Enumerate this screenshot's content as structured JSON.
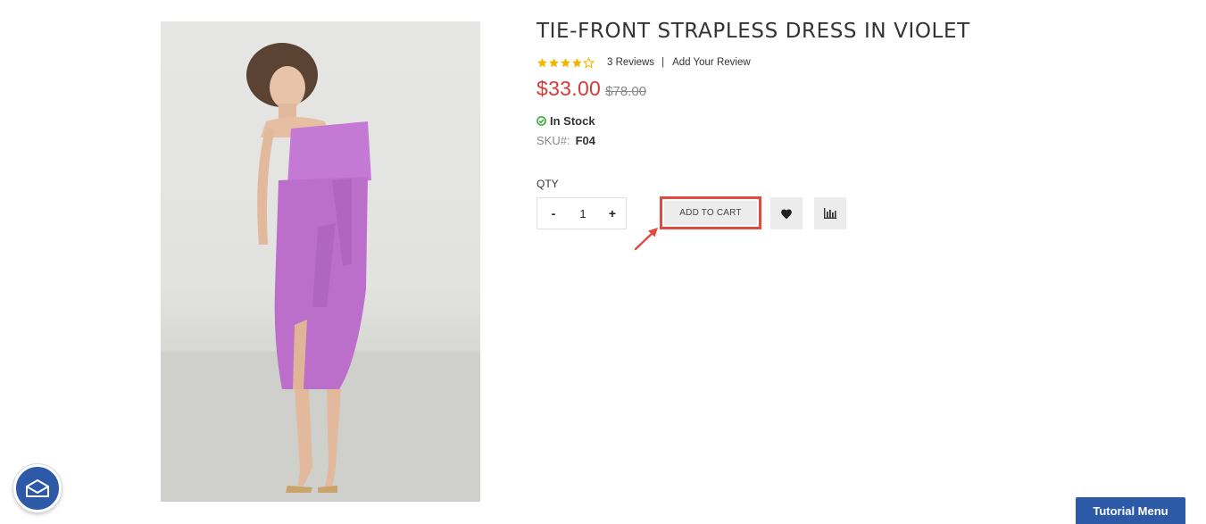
{
  "product": {
    "title": "TIE-FRONT STRAPLESS DRESS IN VIOLET",
    "rating_stars": 4,
    "rating_max": 5,
    "reviews_link": "3 Reviews",
    "separator": "|",
    "add_review_link": "Add Your Review",
    "price_current": "$33.00",
    "price_old": "$78.00",
    "stock_status": "In Stock",
    "sku_label": "SKU#:",
    "sku_value": "F04"
  },
  "purchase": {
    "qty_label": "QTY",
    "qty_minus": "-",
    "qty_value": "1",
    "qty_plus": "+",
    "add_to_cart_label": "ADD TO CART",
    "wishlist_icon": "heart-icon",
    "compare_icon": "bar-chart-icon"
  },
  "footer": {
    "newsletter_icon": "envelope-icon",
    "tutorial_menu_label": "Tutorial Menu"
  },
  "colors": {
    "price_red": "#d63a36",
    "star_gold": "#f2b600",
    "stock_green": "#2aa52a",
    "highlight_red": "#e04a3f",
    "brand_blue": "#2c5aa6",
    "dress_violet": "#c278d3"
  }
}
